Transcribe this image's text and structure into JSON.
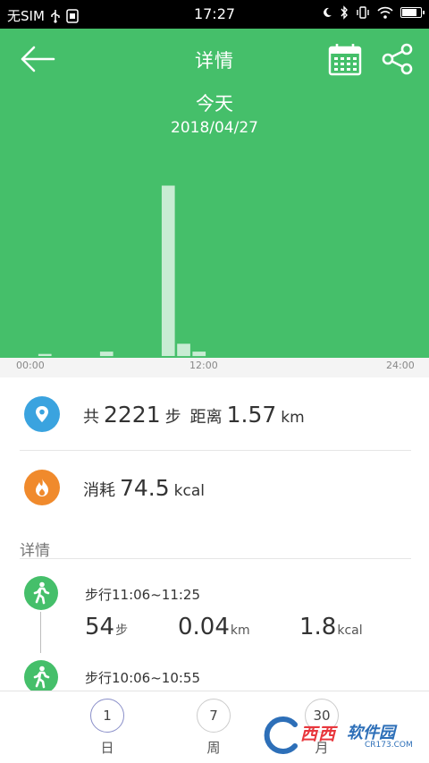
{
  "status_bar": {
    "carrier": "无SIM",
    "time": "17:27",
    "battery_level": 0.85
  },
  "header": {
    "title": "详情",
    "day_label": "今天",
    "date": "2018/04/27",
    "colors": {
      "background": "#45bf6a",
      "bar": "#c8ecd3"
    }
  },
  "chart_data": {
    "type": "bar",
    "x_tick_labels": [
      "00:00",
      "12:00",
      "24:00"
    ],
    "x_range_hours": [
      0,
      24
    ],
    "bins_hours": [
      1,
      5,
      9,
      10,
      11
    ],
    "values": [
      25,
      54,
      2078,
      150,
      54
    ],
    "ylim": [
      0,
      2400
    ]
  },
  "summary": {
    "steps_prefix": "共",
    "steps": "2221",
    "steps_unit": "步",
    "distance_label": "距离",
    "distance": "1.57",
    "distance_unit": "km",
    "calories_label": "消耗",
    "calories": "74.5",
    "calories_unit": "kcal"
  },
  "details": {
    "section_title": "详情",
    "activities": [
      {
        "title": "步行11:06~11:25",
        "steps": "54",
        "steps_unit": "步",
        "distance": "0.04",
        "distance_unit": "km",
        "calories": "1.8",
        "calories_unit": "kcal"
      },
      {
        "title": "步行10:06~10:55"
      }
    ]
  },
  "tabs": [
    {
      "number": "1",
      "label": "日",
      "active": true
    },
    {
      "number": "7",
      "label": "周",
      "active": false
    },
    {
      "number": "30",
      "label": "月",
      "active": false
    }
  ],
  "watermark": {
    "brand": "西西",
    "suffix": "软件园",
    "domain": "CR173.COM"
  }
}
